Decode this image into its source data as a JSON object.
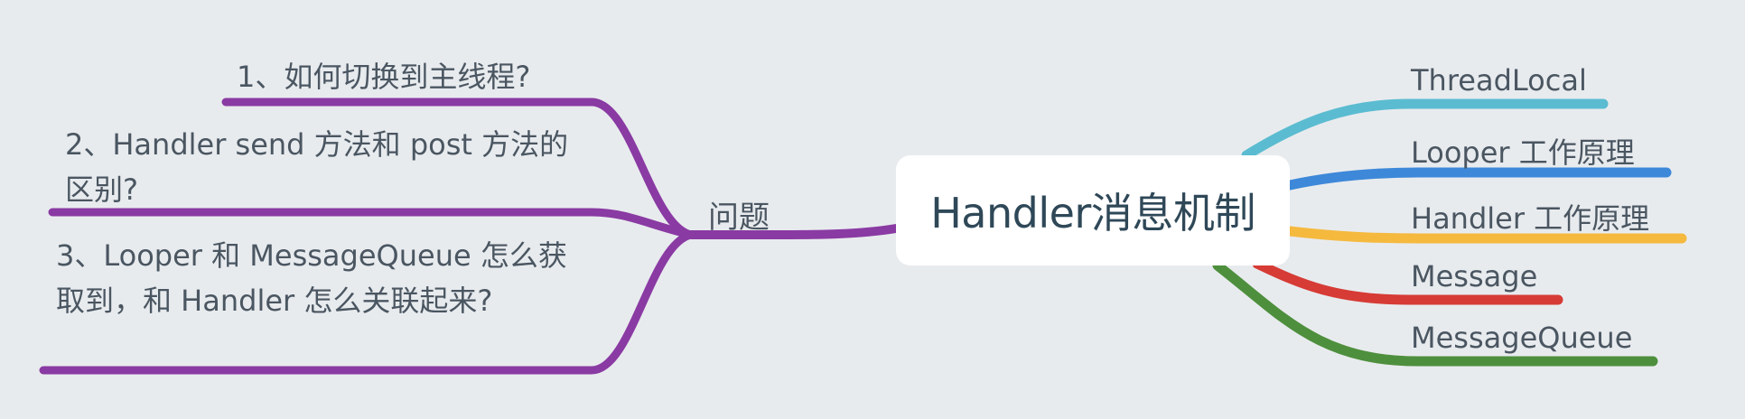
{
  "central_topic": "Handler消息机制",
  "right_branches": [
    {
      "label": "ThreadLocal",
      "color": "#5BBCD1"
    },
    {
      "label": "Looper 工作原理",
      "color": "#3D88D9"
    },
    {
      "label": "Handler 工作原理",
      "color": "#F5B93E"
    },
    {
      "label": "Message",
      "color": "#D63B35"
    },
    {
      "label": "MessageQueue",
      "color": "#4E8F3D"
    }
  ],
  "left_branch": {
    "label": "问题",
    "color": "#8A3AA3",
    "children": [
      {
        "label": "1、如何切换到主线程?"
      },
      {
        "label": "2、Handler send 方法和 post 方法的区别?"
      },
      {
        "label": "3、Looper 和 MessageQueue 怎么获取到，和 Handler 怎么关联起来?"
      }
    ]
  }
}
